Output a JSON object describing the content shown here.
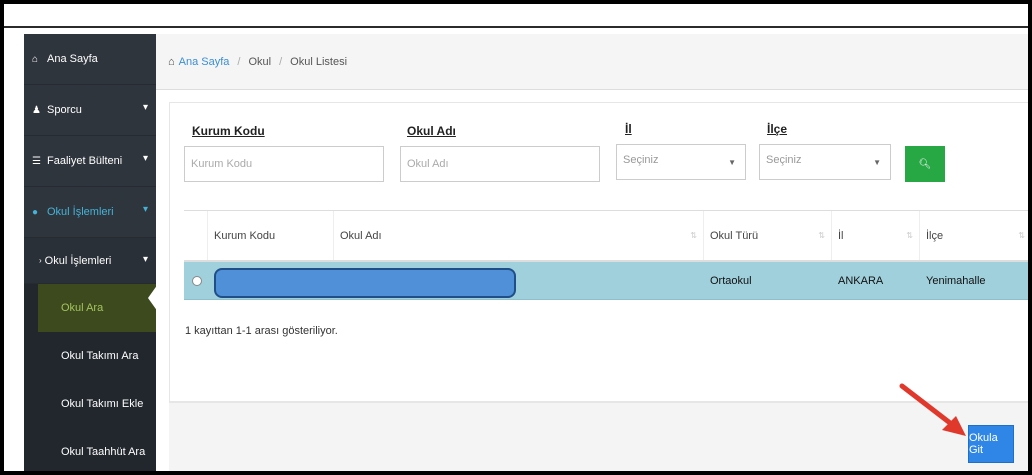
{
  "sidebar": {
    "items": [
      {
        "label": "Ana Sayfa",
        "icon": "home-icon"
      },
      {
        "label": "Sporcu",
        "icon": "users-icon"
      },
      {
        "label": "Faaliyet Bülteni",
        "icon": "list-icon"
      },
      {
        "label": "Okul İşlemleri",
        "icon": "globe-icon"
      }
    ],
    "submenu": {
      "label": "Okul İşlemleri"
    },
    "leaves": [
      "Okul Ara",
      "Okul Takımı Ara",
      "Okul Takımı Ekle",
      "Okul Taahhüt Ara"
    ]
  },
  "breadcrumb": {
    "home": "Ana Sayfa",
    "level1": "Okul",
    "level2": "Okul Listesi"
  },
  "filters": {
    "kurum_kodu": {
      "label": "Kurum Kodu",
      "placeholder": "Kurum Kodu"
    },
    "okul_adi": {
      "label": "Okul Adı",
      "placeholder": "Okul Adı"
    },
    "il": {
      "label": "İl",
      "selected": "Seçiniz"
    },
    "ilce": {
      "label": "İlçe",
      "selected": "Seçiniz"
    }
  },
  "table": {
    "columns": [
      "Kurum Kodu",
      "Okul Adı",
      "Okul Türü",
      "İl",
      "İlçe"
    ],
    "rows": [
      {
        "okul_turu": "Ortaokul",
        "il": "ANKARA",
        "ilce": "Yenimahalle"
      }
    ],
    "info": "1 kayıttan 1-1 arası gösteriliyor."
  },
  "actions": {
    "go_button": "Okula Git"
  },
  "colors": {
    "sidebar": "#2f353d",
    "accent": "#43b3d8",
    "selected_row": "#9fd0dc",
    "search": "#28a745",
    "primary": "#2f86e6",
    "annotation_arrow": "#e0392b"
  }
}
